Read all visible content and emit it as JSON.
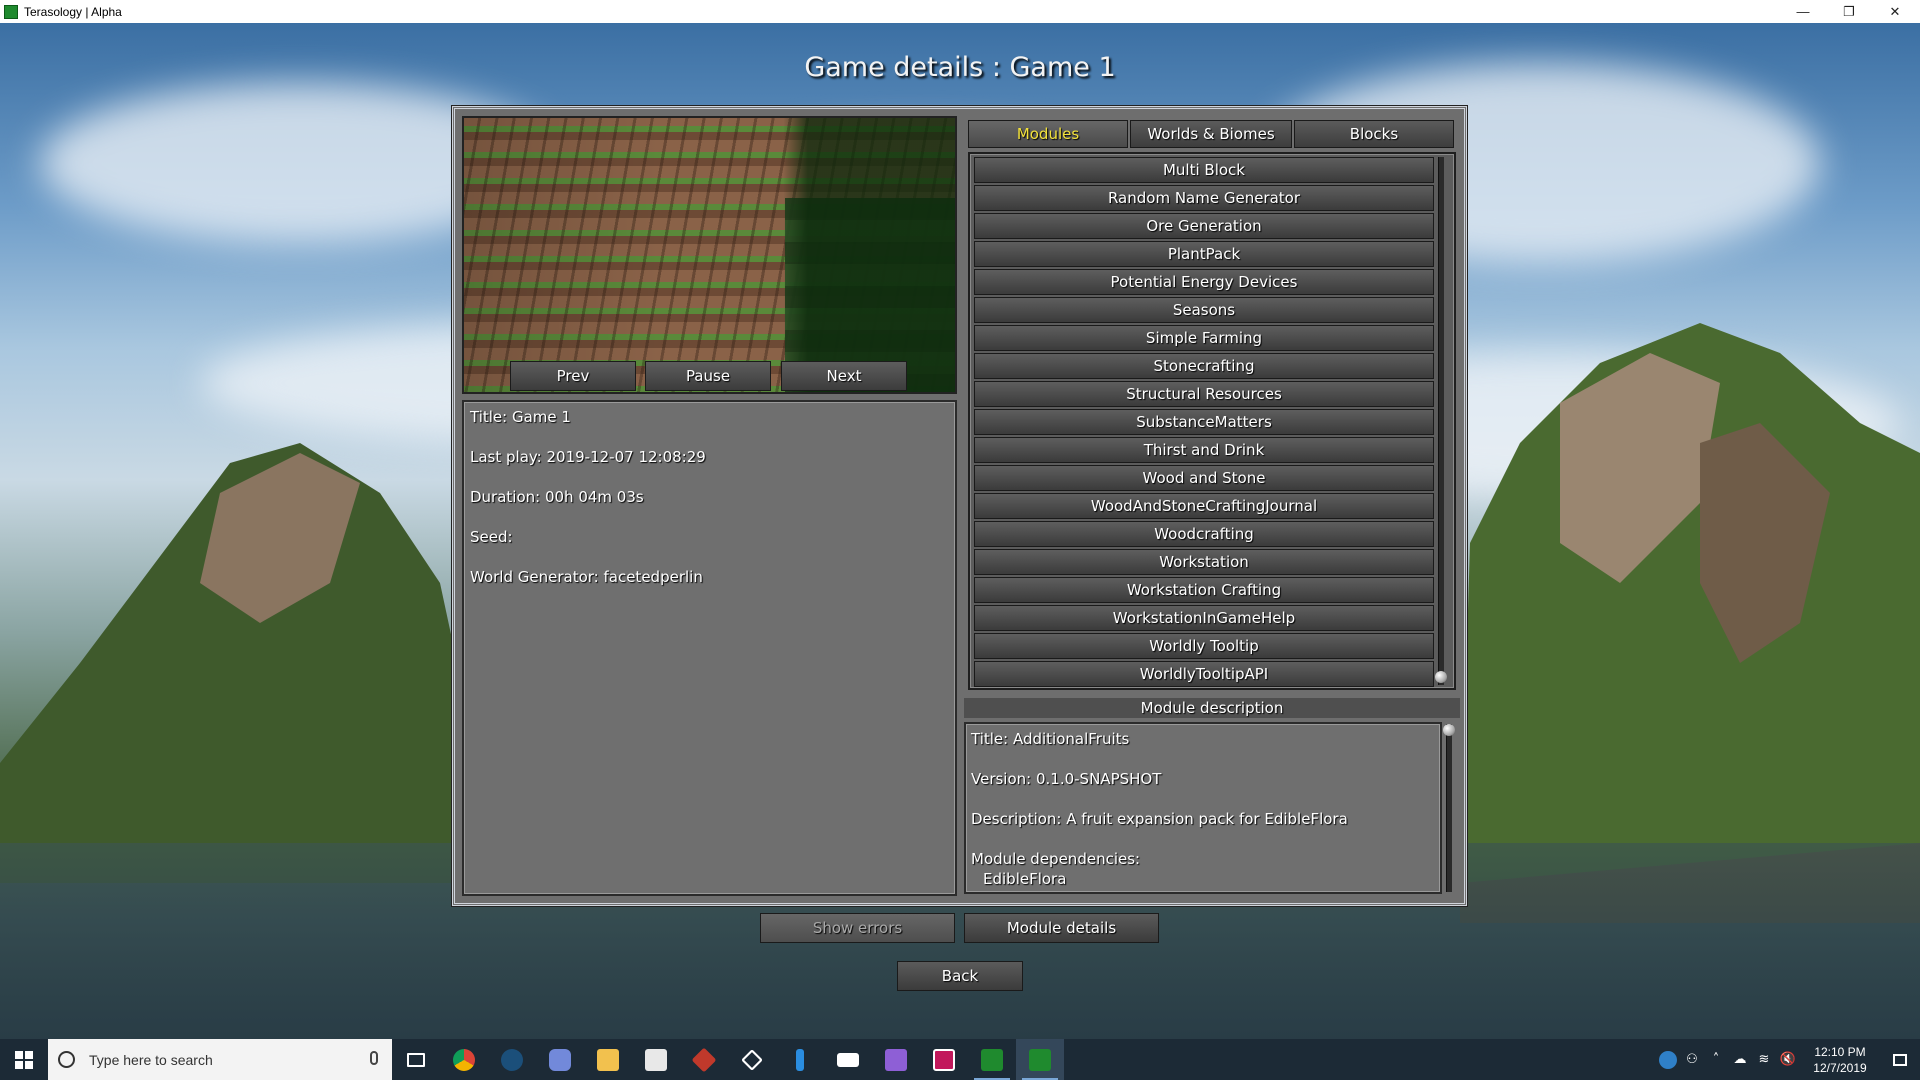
{
  "window": {
    "title": "Terasology | Alpha",
    "minimize_glyph": "—",
    "restore_glyph": "❐",
    "close_glyph": "✕"
  },
  "page_title": "Game details : Game 1",
  "preview": {
    "prev_label": "Prev",
    "pause_label": "Pause",
    "next_label": "Next"
  },
  "game_info": {
    "title": "Title: Game 1",
    "last_play": "Last play: 2019-12-07 12:08:29",
    "duration": "Duration: 00h 04m 03s",
    "seed": "Seed:",
    "world_generator": "World Generator: facetedperlin"
  },
  "tabs": [
    {
      "label": "Modules",
      "active": true
    },
    {
      "label": "Worlds & Biomes",
      "active": false
    },
    {
      "label": "Blocks",
      "active": false
    }
  ],
  "modules": [
    "Multi Block",
    "Random Name Generator",
    "Ore Generation",
    "PlantPack",
    "Potential Energy Devices",
    "Seasons",
    "Simple Farming",
    "Stonecrafting",
    "Structural Resources",
    "SubstanceMatters",
    "Thirst and Drink",
    "Wood and Stone",
    "WoodAndStoneCraftingJournal",
    "Woodcrafting",
    "Workstation",
    "Workstation Crafting",
    "WorkstationInGameHelp",
    "Worldly Tooltip",
    "WorldlyTooltipAPI"
  ],
  "module_description": {
    "header": "Module description",
    "title": "Title: AdditionalFruits",
    "version": "Version: 0.1.0-SNAPSHOT",
    "description": "Description: A fruit expansion pack for EdibleFlora",
    "dependencies_label": "Module dependencies:",
    "dependencies": [
      "EdibleFlora"
    ]
  },
  "buttons": {
    "show_errors": "Show errors",
    "module_details": "Module details",
    "back": "Back"
  },
  "taskbar": {
    "search_placeholder": "Type here to search",
    "apps": [
      "task-view",
      "chrome",
      "steam",
      "discord",
      "file-explorer",
      "store",
      "app-red",
      "dropbox",
      "app-blue",
      "mail",
      "visual-studio",
      "intellij",
      "terasology-1",
      "terasology-2"
    ],
    "clock_time": "12:10 PM",
    "clock_date": "12/7/2019"
  },
  "colors": {
    "active_tab": "#f2e13a",
    "panel": "#6e6e6e",
    "taskbar": "#1c2a36"
  }
}
